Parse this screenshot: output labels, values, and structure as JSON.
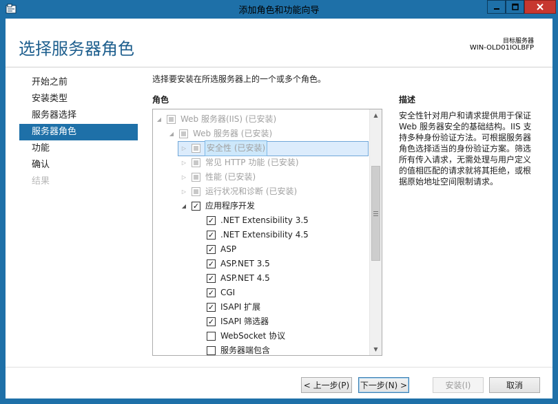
{
  "window": {
    "title": "添加角色和功能向导"
  },
  "header": {
    "page_title": "选择服务器角色",
    "target_label": "目标服务器",
    "target_value": "WIN-OLD01IOLBFP"
  },
  "nav": {
    "items": [
      {
        "label": "开始之前",
        "state": "normal"
      },
      {
        "label": "安装类型",
        "state": "normal"
      },
      {
        "label": "服务器选择",
        "state": "normal"
      },
      {
        "label": "服务器角色",
        "state": "active"
      },
      {
        "label": "功能",
        "state": "normal"
      },
      {
        "label": "确认",
        "state": "normal"
      },
      {
        "label": "结果",
        "state": "disabled"
      }
    ]
  },
  "main": {
    "instruction": "选择要安装在所选服务器上的一个或多个角色。",
    "roles_label": "角色",
    "tree": [
      {
        "label": "Web 服务器(IIS) (已安装)",
        "expander": "expanded",
        "check": "installed"
      },
      {
        "label": "Web 服务器 (已安装)",
        "expander": "expanded",
        "check": "installed"
      },
      {
        "label": "安全性 (已安装)",
        "expander": "collapsed",
        "check": "installed"
      },
      {
        "label": "常见 HTTP 功能 (已安装)",
        "expander": "collapsed",
        "check": "installed"
      },
      {
        "label": "性能 (已安装)",
        "expander": "collapsed",
        "check": "installed"
      },
      {
        "label": "运行状况和诊断 (已安装)",
        "expander": "collapsed",
        "check": "installed"
      },
      {
        "label": "应用程序开发",
        "expander": "expanded",
        "check": "checked"
      },
      {
        "label": ".NET Extensibility 3.5",
        "expander": "none",
        "check": "checked"
      },
      {
        "label": ".NET Extensibility 4.5",
        "expander": "none",
        "check": "checked"
      },
      {
        "label": "ASP",
        "expander": "none",
        "check": "checked"
      },
      {
        "label": "ASP.NET 3.5",
        "expander": "none",
        "check": "checked"
      },
      {
        "label": "ASP.NET 4.5",
        "expander": "none",
        "check": "checked"
      },
      {
        "label": "CGI",
        "expander": "none",
        "check": "checked"
      },
      {
        "label": "ISAPI 扩展",
        "expander": "none",
        "check": "checked"
      },
      {
        "label": "ISAPI 筛选器",
        "expander": "none",
        "check": "checked"
      },
      {
        "label": "WebSocket 协议",
        "expander": "none",
        "check": "unchecked"
      },
      {
        "label": "服务器端包含",
        "expander": "none",
        "check": "unchecked"
      }
    ]
  },
  "description": {
    "label": "描述",
    "text": "安全性针对用户和请求提供用于保证 Web 服务器安全的基础结构。IIS 支持多种身份验证方法。可根据服务器角色选择适当的身份验证方案。筛选所有传入请求，无需处理与用户定义的值相匹配的请求就将其拒绝，或根据原始地址空间限制请求。"
  },
  "footer": {
    "prev_label": "< 上一步(P)",
    "next_label": "下一步(N) >",
    "install_label": "安装(I)",
    "cancel_label": "取消"
  },
  "colors": {
    "accent": "#1e70a8",
    "title_text": "#1e5f8e",
    "close_button": "#c7372f"
  }
}
